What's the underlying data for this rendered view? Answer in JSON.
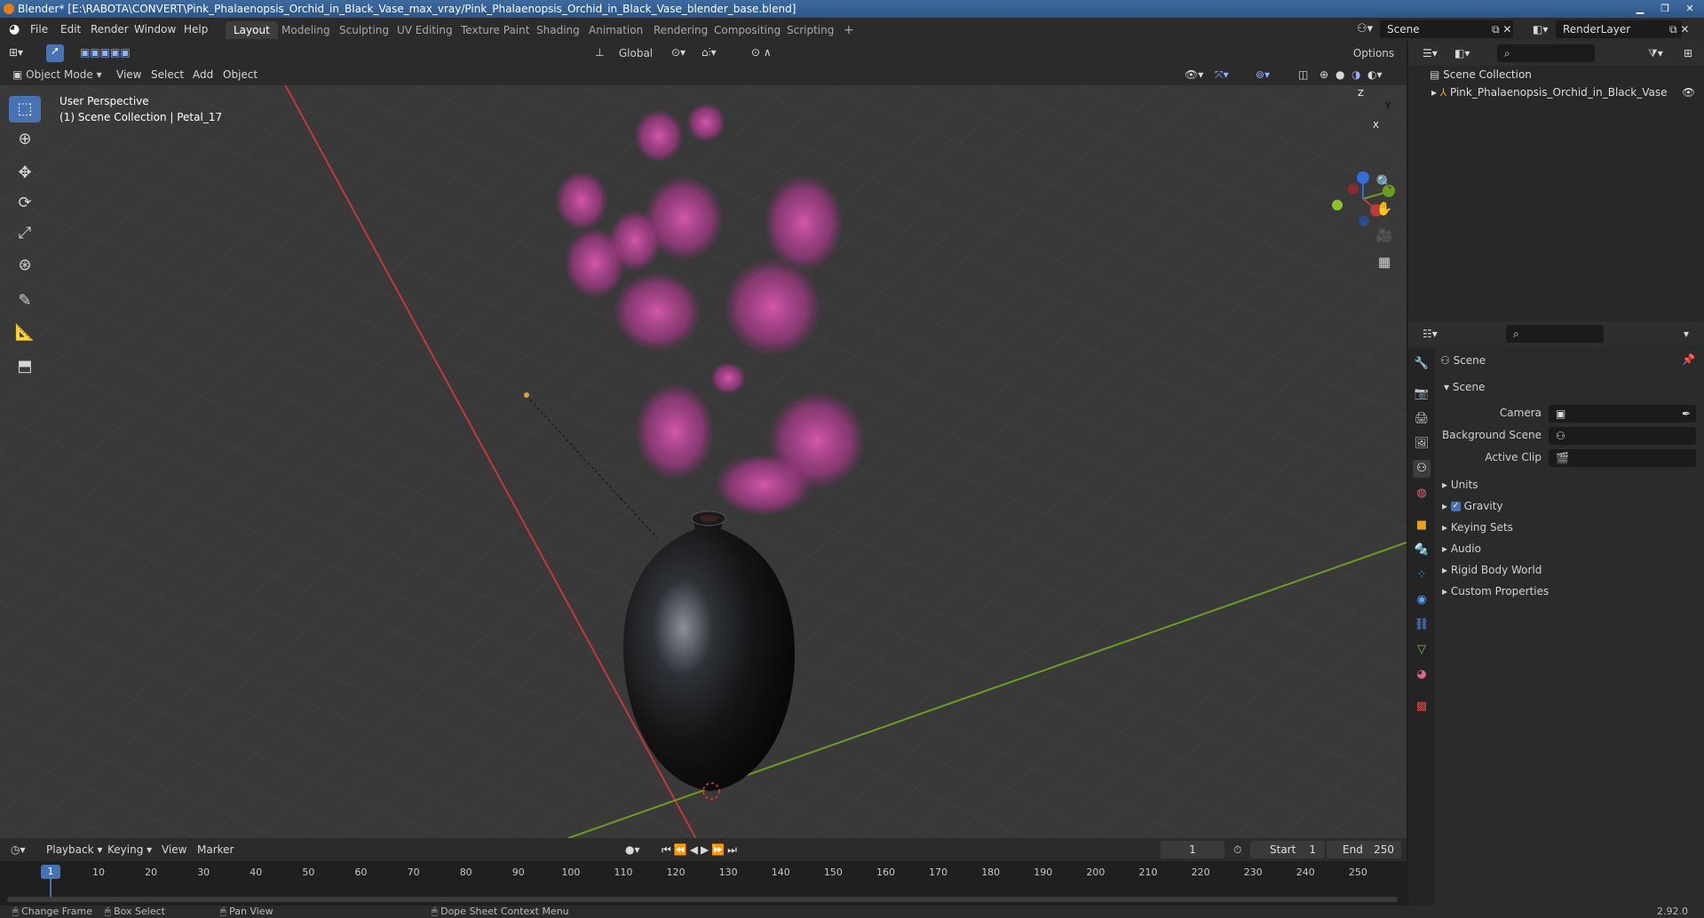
{
  "titlebar": {
    "title": "Blender* [E:\\RABOTA\\CONVERT\\Pink_Phalaenopsis_Orchid_in_Black_Vase_max_vray/Pink_Phalaenopsis_Orchid_in_Black_Vase_blender_base.blend]"
  },
  "menu": {
    "file": "File",
    "edit": "Edit",
    "render": "Render",
    "window": "Window",
    "help": "Help"
  },
  "workspaces": [
    "Layout",
    "Modeling",
    "Sculpting",
    "UV Editing",
    "Texture Paint",
    "Shading",
    "Animation",
    "Rendering",
    "Compositing",
    "Scripting"
  ],
  "scene_field": "Scene",
  "renderlayer_field": "RenderLayer",
  "viewport_header": {
    "mode": "Object Mode",
    "view": "View",
    "select": "Select",
    "add": "Add",
    "object": "Object",
    "transform": "Global",
    "options": "Options"
  },
  "viewport": {
    "perspective": "User Perspective",
    "collection_info": "(1) Scene Collection | Petal_17"
  },
  "gizmo": {
    "z": "Z",
    "y": "Y",
    "x": "X"
  },
  "outliner": {
    "root": "Scene Collection",
    "item": "Pink_Phalaenopsis_Orchid_in_Black_Vase"
  },
  "properties": {
    "breadcrumb": "Scene",
    "panel_title": "Scene",
    "camera_label": "Camera",
    "background_label": "Background Scene",
    "clip_label": "Active Clip",
    "sections": [
      "Units",
      "Gravity",
      "Keying Sets",
      "Audio",
      "Rigid Body World",
      "Custom Properties"
    ],
    "gravity_checked": true
  },
  "timeline": {
    "playback": "Playback",
    "keying": "Keying",
    "view": "View",
    "marker": "Marker",
    "current_frame": "1",
    "start_label": "Start",
    "start": "1",
    "end_label": "End",
    "end": "250",
    "ticks": [
      "10",
      "20",
      "30",
      "40",
      "50",
      "60",
      "70",
      "80",
      "90",
      "100",
      "110",
      "120",
      "130",
      "140",
      "150",
      "160",
      "170",
      "180",
      "190",
      "200",
      "210",
      "220",
      "230",
      "240",
      "250"
    ],
    "playhead": "1"
  },
  "status": {
    "change_frame": "Change Frame",
    "box_select": "Box Select",
    "pan_view": "Pan View",
    "context": "Dope Sheet Context Menu",
    "version": "2.92.0"
  },
  "colors": {
    "accent": "#4772b3",
    "orange": "#e87d0d",
    "petal": "#d445a8",
    "x_axis": "#c0393b",
    "y_axis": "#6b9e1f"
  }
}
